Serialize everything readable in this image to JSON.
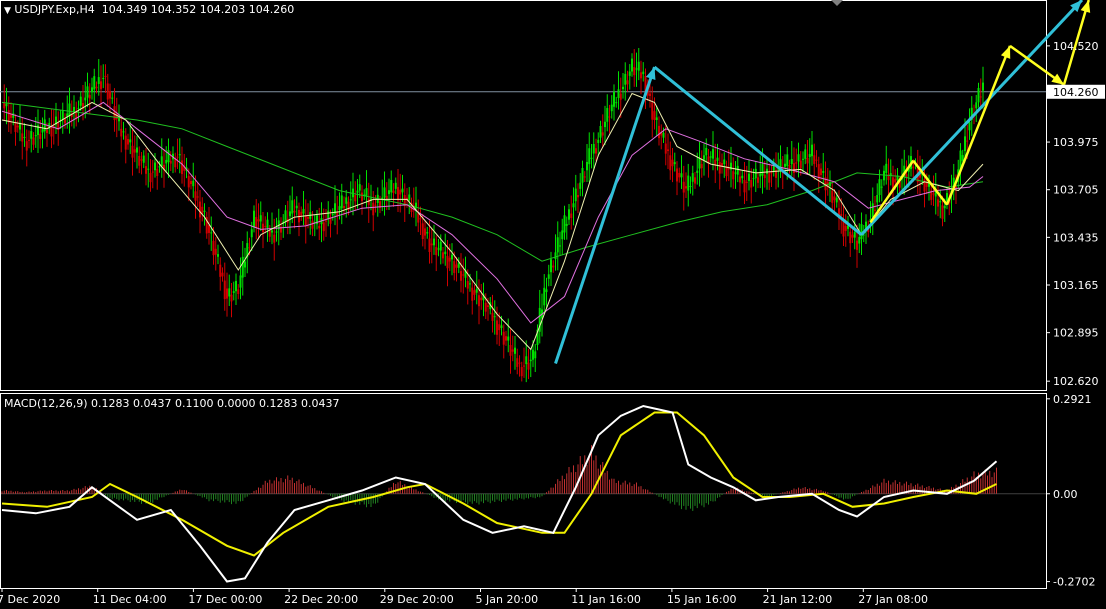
{
  "header": {
    "symbol": "USDJPY.Exp,H4",
    "ohlc": "104.349 104.352 104.203 104.260",
    "macd_label": "MACD(12,26,9) 0.1283 0.0437 0.1100 0.0000 0.1283 0.0437"
  },
  "colors": {
    "background": "#000000",
    "bull": "#00e000",
    "bear": "#d00000",
    "ma_fast": "#f0f0b0",
    "ma_mid": "#e070e0",
    "ma_slow": "#20c020",
    "cyan": "#30c0d8",
    "yellow": "#ffff20",
    "hist_up": "#c03030",
    "hist_down": "#208020",
    "macd": "#ffffff",
    "signal": "#f0f000"
  },
  "chart_data": [
    {
      "type": "candlestick",
      "symbol": "USDJPY.Exp",
      "timeframe": "H4",
      "current_price": 104.26,
      "current_price_label": "104.260",
      "y_ticks": [
        "104.520",
        "103.975",
        "103.705",
        "103.435",
        "103.165",
        "102.895",
        "102.620"
      ],
      "y_tick_values": [
        104.52,
        103.975,
        103.705,
        103.435,
        103.165,
        102.895,
        102.62
      ],
      "ylim": [
        102.57,
        104.78
      ],
      "x_ticks": [
        "7 Dec 2020",
        "11 Dec 04:00",
        "17 Dec 00:00",
        "22 Dec 20:00",
        "29 Dec 20:00",
        "5 Jan 20:00",
        "11 Jan 16:00",
        "15 Jan 16:00",
        "21 Jan 12:00",
        "27 Jan 08:00"
      ],
      "close_path": [
        [
          0,
          104.2
        ],
        [
          10,
          103.98
        ],
        [
          20,
          104.05
        ],
        [
          32,
          104.15
        ],
        [
          45,
          104.35
        ],
        [
          52,
          104.05
        ],
        [
          65,
          103.8
        ],
        [
          78,
          103.9
        ],
        [
          90,
          103.55
        ],
        [
          100,
          103.1
        ],
        [
          105,
          103.15
        ],
        [
          112,
          103.55
        ],
        [
          120,
          103.45
        ],
        [
          130,
          103.6
        ],
        [
          140,
          103.5
        ],
        [
          150,
          103.6
        ],
        [
          158,
          103.7
        ],
        [
          165,
          103.62
        ],
        [
          175,
          103.72
        ],
        [
          183,
          103.6
        ],
        [
          190,
          103.4
        ],
        [
          200,
          103.3
        ],
        [
          208,
          103.15
        ],
        [
          215,
          103.05
        ],
        [
          222,
          102.9
        ],
        [
          230,
          102.7
        ],
        [
          236,
          102.75
        ],
        [
          242,
          103.2
        ],
        [
          250,
          103.5
        ],
        [
          260,
          103.85
        ],
        [
          270,
          104.15
        ],
        [
          280,
          104.4
        ],
        [
          285,
          104.35
        ],
        [
          290,
          104.1
        ],
        [
          296,
          103.9
        ],
        [
          304,
          103.7
        ],
        [
          312,
          103.9
        ],
        [
          320,
          103.85
        ],
        [
          330,
          103.75
        ],
        [
          340,
          103.8
        ],
        [
          350,
          103.85
        ],
        [
          360,
          103.9
        ],
        [
          368,
          103.7
        ],
        [
          374,
          103.5
        ],
        [
          380,
          103.4
        ],
        [
          386,
          103.55
        ],
        [
          392,
          103.8
        ],
        [
          398,
          103.75
        ],
        [
          405,
          103.85
        ],
        [
          412,
          103.7
        ],
        [
          418,
          103.6
        ],
        [
          424,
          103.75
        ],
        [
          430,
          104.1
        ],
        [
          436,
          104.3
        ]
      ],
      "ma_fast_path": [
        [
          0,
          104.1
        ],
        [
          20,
          104.05
        ],
        [
          40,
          104.2
        ],
        [
          55,
          104.1
        ],
        [
          70,
          103.85
        ],
        [
          90,
          103.55
        ],
        [
          105,
          103.25
        ],
        [
          115,
          103.45
        ],
        [
          130,
          103.55
        ],
        [
          150,
          103.58
        ],
        [
          165,
          103.65
        ],
        [
          180,
          103.65
        ],
        [
          200,
          103.35
        ],
        [
          220,
          103.0
        ],
        [
          235,
          102.8
        ],
        [
          250,
          103.3
        ],
        [
          265,
          103.9
        ],
        [
          280,
          104.25
        ],
        [
          290,
          104.2
        ],
        [
          300,
          103.95
        ],
        [
          315,
          103.85
        ],
        [
          335,
          103.8
        ],
        [
          355,
          103.82
        ],
        [
          370,
          103.7
        ],
        [
          382,
          103.45
        ],
        [
          395,
          103.65
        ],
        [
          410,
          103.75
        ],
        [
          425,
          103.7
        ],
        [
          436,
          103.85
        ]
      ],
      "ma_mid_path": [
        [
          0,
          104.15
        ],
        [
          25,
          104.05
        ],
        [
          45,
          104.2
        ],
        [
          60,
          104.05
        ],
        [
          80,
          103.85
        ],
        [
          100,
          103.55
        ],
        [
          115,
          103.48
        ],
        [
          135,
          103.5
        ],
        [
          160,
          103.6
        ],
        [
          180,
          103.62
        ],
        [
          200,
          103.45
        ],
        [
          220,
          103.2
        ],
        [
          235,
          102.95
        ],
        [
          250,
          103.1
        ],
        [
          265,
          103.55
        ],
        [
          280,
          103.9
        ],
        [
          295,
          104.05
        ],
        [
          310,
          103.98
        ],
        [
          330,
          103.88
        ],
        [
          350,
          103.82
        ],
        [
          370,
          103.75
        ],
        [
          385,
          103.6
        ],
        [
          400,
          103.65
        ],
        [
          415,
          103.7
        ],
        [
          430,
          103.72
        ],
        [
          436,
          103.78
        ]
      ],
      "ma_slow_path": [
        [
          0,
          104.2
        ],
        [
          30,
          104.15
        ],
        [
          60,
          104.1
        ],
        [
          80,
          104.05
        ],
        [
          100,
          103.95
        ],
        [
          120,
          103.85
        ],
        [
          150,
          103.7
        ],
        [
          180,
          103.62
        ],
        [
          200,
          103.55
        ],
        [
          220,
          103.45
        ],
        [
          240,
          103.3
        ],
        [
          260,
          103.38
        ],
        [
          280,
          103.45
        ],
        [
          300,
          103.52
        ],
        [
          320,
          103.58
        ],
        [
          340,
          103.62
        ],
        [
          360,
          103.7
        ],
        [
          380,
          103.8
        ],
        [
          400,
          103.78
        ],
        [
          420,
          103.72
        ],
        [
          436,
          103.75
        ]
      ],
      "annotations": [
        {
          "color": "cyan",
          "arrow": true,
          "points": [
            [
              246,
              102.72
            ],
            [
              290,
              104.4
            ]
          ]
        },
        {
          "color": "cyan",
          "arrow": false,
          "points": [
            [
              290,
              104.4
            ],
            [
              382,
              103.45
            ]
          ]
        },
        {
          "color": "cyan",
          "arrow": true,
          "points": [
            [
              382,
              103.45
            ],
            [
              480,
              104.78
            ]
          ]
        },
        {
          "color": "yellow",
          "arrow": false,
          "points": [
            [
              386,
              103.52
            ],
            [
              405,
              103.87
            ]
          ]
        },
        {
          "color": "yellow",
          "arrow": false,
          "points": [
            [
              405,
              103.87
            ],
            [
              420,
              103.62
            ]
          ]
        },
        {
          "color": "yellow",
          "arrow": true,
          "points": [
            [
              420,
              103.62
            ],
            [
              448,
              104.52
            ]
          ]
        },
        {
          "color": "yellow",
          "arrow": true,
          "points": [
            [
              448,
              104.52
            ],
            [
              472,
              104.3
            ]
          ]
        },
        {
          "color": "yellow",
          "arrow": true,
          "points": [
            [
              472,
              104.3
            ],
            [
              483,
              104.78
            ]
          ]
        }
      ]
    },
    {
      "type": "macd",
      "params": [
        12,
        26,
        9
      ],
      "y_ticks": [
        "0.2921",
        "0.00",
        "-0.2702"
      ],
      "y_tick_values": [
        0.2921,
        0.0,
        -0.2702
      ],
      "ylim": [
        -0.29,
        0.31
      ],
      "macd_path": [
        [
          0,
          -0.05
        ],
        [
          15,
          -0.06
        ],
        [
          30,
          -0.04
        ],
        [
          40,
          0.02
        ],
        [
          48,
          -0.02
        ],
        [
          60,
          -0.08
        ],
        [
          75,
          -0.05
        ],
        [
          88,
          -0.16
        ],
        [
          100,
          -0.27
        ],
        [
          108,
          -0.26
        ],
        [
          118,
          -0.15
        ],
        [
          130,
          -0.05
        ],
        [
          145,
          -0.02
        ],
        [
          160,
          0.01
        ],
        [
          175,
          0.05
        ],
        [
          188,
          0.03
        ],
        [
          205,
          -0.08
        ],
        [
          218,
          -0.12
        ],
        [
          232,
          -0.1
        ],
        [
          245,
          -0.12
        ],
        [
          255,
          0.02
        ],
        [
          265,
          0.18
        ],
        [
          275,
          0.24
        ],
        [
          285,
          0.27
        ],
        [
          298,
          0.25
        ],
        [
          305,
          0.09
        ],
        [
          315,
          0.05
        ],
        [
          325,
          0.02
        ],
        [
          335,
          -0.02
        ],
        [
          345,
          -0.01
        ],
        [
          360,
          0.0
        ],
        [
          372,
          -0.05
        ],
        [
          380,
          -0.07
        ],
        [
          392,
          -0.01
        ],
        [
          405,
          0.01
        ],
        [
          420,
          0.0
        ],
        [
          432,
          0.04
        ],
        [
          442,
          0.1
        ]
      ],
      "signal_path": [
        [
          0,
          -0.03
        ],
        [
          20,
          -0.04
        ],
        [
          40,
          -0.01
        ],
        [
          48,
          0.03
        ],
        [
          60,
          -0.01
        ],
        [
          80,
          -0.08
        ],
        [
          100,
          -0.16
        ],
        [
          112,
          -0.19
        ],
        [
          125,
          -0.12
        ],
        [
          145,
          -0.04
        ],
        [
          165,
          -0.01
        ],
        [
          180,
          0.02
        ],
        [
          188,
          0.03
        ],
        [
          205,
          -0.03
        ],
        [
          220,
          -0.09
        ],
        [
          240,
          -0.12
        ],
        [
          250,
          -0.12
        ],
        [
          262,
          0.0
        ],
        [
          275,
          0.18
        ],
        [
          290,
          0.25
        ],
        [
          300,
          0.25
        ],
        [
          312,
          0.18
        ],
        [
          325,
          0.05
        ],
        [
          338,
          -0.01
        ],
        [
          350,
          -0.01
        ],
        [
          365,
          0.0
        ],
        [
          378,
          -0.04
        ],
        [
          392,
          -0.03
        ],
        [
          405,
          -0.01
        ],
        [
          420,
          0.01
        ],
        [
          433,
          0.0
        ],
        [
          442,
          0.03
        ]
      ],
      "histogram": [
        [
          2,
          0.01
        ],
        [
          10,
          0.005
        ],
        [
          20,
          0.01
        ],
        [
          30,
          0.01
        ],
        [
          40,
          0.025
        ],
        [
          48,
          -0.015
        ],
        [
          55,
          -0.02
        ],
        [
          65,
          -0.03
        ],
        [
          80,
          0.015
        ],
        [
          92,
          -0.02
        ],
        [
          105,
          -0.03
        ],
        [
          118,
          0.04
        ],
        [
          128,
          0.05
        ],
        [
          138,
          0.02
        ],
        [
          150,
          -0.02
        ],
        [
          165,
          -0.04
        ],
        [
          175,
          0.04
        ],
        [
          185,
          0.01
        ],
        [
          195,
          -0.02
        ],
        [
          210,
          -0.03
        ],
        [
          225,
          -0.02
        ],
        [
          240,
          -0.01
        ],
        [
          250,
          0.06
        ],
        [
          262,
          0.13
        ],
        [
          272,
          0.04
        ],
        [
          282,
          0.03
        ],
        [
          295,
          -0.02
        ],
        [
          305,
          -0.05
        ],
        [
          315,
          -0.03
        ],
        [
          325,
          0.02
        ],
        [
          340,
          -0.01
        ],
        [
          355,
          0.02
        ],
        [
          365,
          0.01
        ],
        [
          375,
          -0.02
        ],
        [
          392,
          0.04
        ],
        [
          405,
          0.03
        ],
        [
          420,
          0.01
        ],
        [
          432,
          0.06
        ],
        [
          442,
          0.07
        ]
      ]
    }
  ]
}
